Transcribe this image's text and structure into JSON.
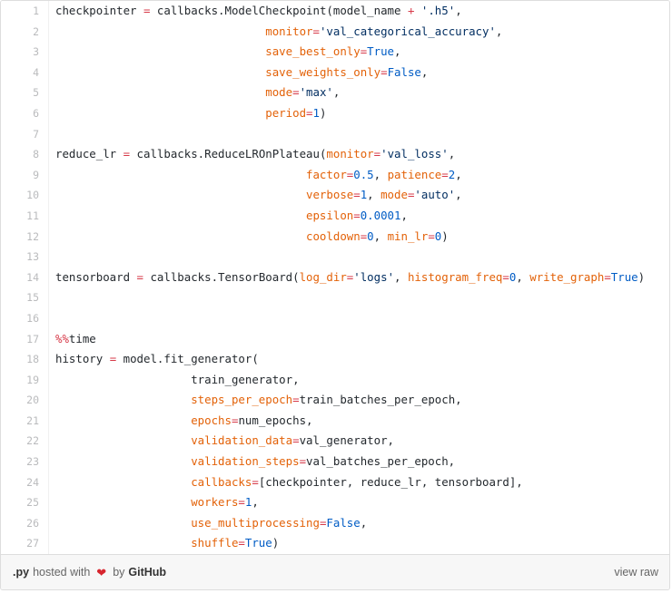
{
  "gist": {
    "language_ext": ".py",
    "hosted_with_text": "hosted with",
    "heart_icon": "heart-icon",
    "by_text": "by",
    "brand": "GitHub",
    "view_raw_label": "view raw",
    "colors": {
      "operator": "#d73a49",
      "keyword_arg": "#e36209",
      "string": "#032f62",
      "number": "#005cc5",
      "constant": "#005cc5",
      "plain": "#24292e",
      "line_number": "#babbbd",
      "footer_bg": "#f7f7f7",
      "border": "#dddddd",
      "heart": "#d7252e"
    }
  },
  "code": {
    "lines": [
      {
        "num": "1",
        "tokens": [
          {
            "t": "plain",
            "v": "checkpointer "
          },
          {
            "t": "op",
            "v": "="
          },
          {
            "t": "plain",
            "v": " callbacks.ModelCheckpoint(model_name "
          },
          {
            "t": "op",
            "v": "+"
          },
          {
            "t": "plain",
            "v": " "
          },
          {
            "t": "str",
            "v": "'.h5'"
          },
          {
            "t": "plain",
            "v": ","
          }
        ]
      },
      {
        "num": "2",
        "tokens": [
          {
            "t": "plain",
            "v": "                               "
          },
          {
            "t": "kwarg",
            "v": "monitor"
          },
          {
            "t": "op",
            "v": "="
          },
          {
            "t": "str",
            "v": "'val_categorical_accuracy'"
          },
          {
            "t": "plain",
            "v": ","
          }
        ]
      },
      {
        "num": "3",
        "tokens": [
          {
            "t": "plain",
            "v": "                               "
          },
          {
            "t": "kwarg",
            "v": "save_best_only"
          },
          {
            "t": "op",
            "v": "="
          },
          {
            "t": "const",
            "v": "True"
          },
          {
            "t": "plain",
            "v": ","
          }
        ]
      },
      {
        "num": "4",
        "tokens": [
          {
            "t": "plain",
            "v": "                               "
          },
          {
            "t": "kwarg",
            "v": "save_weights_only"
          },
          {
            "t": "op",
            "v": "="
          },
          {
            "t": "const",
            "v": "False"
          },
          {
            "t": "plain",
            "v": ","
          }
        ]
      },
      {
        "num": "5",
        "tokens": [
          {
            "t": "plain",
            "v": "                               "
          },
          {
            "t": "kwarg",
            "v": "mode"
          },
          {
            "t": "op",
            "v": "="
          },
          {
            "t": "str",
            "v": "'max'"
          },
          {
            "t": "plain",
            "v": ","
          }
        ]
      },
      {
        "num": "6",
        "tokens": [
          {
            "t": "plain",
            "v": "                               "
          },
          {
            "t": "kwarg",
            "v": "period"
          },
          {
            "t": "op",
            "v": "="
          },
          {
            "t": "num",
            "v": "1"
          },
          {
            "t": "plain",
            "v": ")"
          }
        ]
      },
      {
        "num": "7",
        "tokens": []
      },
      {
        "num": "8",
        "tokens": [
          {
            "t": "plain",
            "v": "reduce_lr "
          },
          {
            "t": "op",
            "v": "="
          },
          {
            "t": "plain",
            "v": " callbacks.ReduceLROnPlateau("
          },
          {
            "t": "kwarg",
            "v": "monitor"
          },
          {
            "t": "op",
            "v": "="
          },
          {
            "t": "str",
            "v": "'val_loss'"
          },
          {
            "t": "plain",
            "v": ","
          }
        ]
      },
      {
        "num": "9",
        "tokens": [
          {
            "t": "plain",
            "v": "                                     "
          },
          {
            "t": "kwarg",
            "v": "factor"
          },
          {
            "t": "op",
            "v": "="
          },
          {
            "t": "num",
            "v": "0.5"
          },
          {
            "t": "plain",
            "v": ", "
          },
          {
            "t": "kwarg",
            "v": "patience"
          },
          {
            "t": "op",
            "v": "="
          },
          {
            "t": "num",
            "v": "2"
          },
          {
            "t": "plain",
            "v": ","
          }
        ]
      },
      {
        "num": "10",
        "tokens": [
          {
            "t": "plain",
            "v": "                                     "
          },
          {
            "t": "kwarg",
            "v": "verbose"
          },
          {
            "t": "op",
            "v": "="
          },
          {
            "t": "num",
            "v": "1"
          },
          {
            "t": "plain",
            "v": ", "
          },
          {
            "t": "kwarg",
            "v": "mode"
          },
          {
            "t": "op",
            "v": "="
          },
          {
            "t": "str",
            "v": "'auto'"
          },
          {
            "t": "plain",
            "v": ","
          }
        ]
      },
      {
        "num": "11",
        "tokens": [
          {
            "t": "plain",
            "v": "                                     "
          },
          {
            "t": "kwarg",
            "v": "epsilon"
          },
          {
            "t": "op",
            "v": "="
          },
          {
            "t": "num",
            "v": "0.0001"
          },
          {
            "t": "plain",
            "v": ","
          }
        ]
      },
      {
        "num": "12",
        "tokens": [
          {
            "t": "plain",
            "v": "                                     "
          },
          {
            "t": "kwarg",
            "v": "cooldown"
          },
          {
            "t": "op",
            "v": "="
          },
          {
            "t": "num",
            "v": "0"
          },
          {
            "t": "plain",
            "v": ", "
          },
          {
            "t": "kwarg",
            "v": "min_lr"
          },
          {
            "t": "op",
            "v": "="
          },
          {
            "t": "num",
            "v": "0"
          },
          {
            "t": "plain",
            "v": ")"
          }
        ]
      },
      {
        "num": "13",
        "tokens": []
      },
      {
        "num": "14",
        "tokens": [
          {
            "t": "plain",
            "v": "tensorboard "
          },
          {
            "t": "op",
            "v": "="
          },
          {
            "t": "plain",
            "v": " callbacks.TensorBoard("
          },
          {
            "t": "kwarg",
            "v": "log_dir"
          },
          {
            "t": "op",
            "v": "="
          },
          {
            "t": "str",
            "v": "'logs'"
          },
          {
            "t": "plain",
            "v": ", "
          },
          {
            "t": "kwarg",
            "v": "histogram_freq"
          },
          {
            "t": "op",
            "v": "="
          },
          {
            "t": "num",
            "v": "0"
          },
          {
            "t": "plain",
            "v": ", "
          },
          {
            "t": "kwarg",
            "v": "write_graph"
          },
          {
            "t": "op",
            "v": "="
          },
          {
            "t": "const",
            "v": "True"
          },
          {
            "t": "plain",
            "v": ")"
          }
        ]
      },
      {
        "num": "15",
        "tokens": []
      },
      {
        "num": "16",
        "tokens": []
      },
      {
        "num": "17",
        "tokens": [
          {
            "t": "magic",
            "v": "%%"
          },
          {
            "t": "plain",
            "v": "time"
          }
        ]
      },
      {
        "num": "18",
        "tokens": [
          {
            "t": "plain",
            "v": "history "
          },
          {
            "t": "op",
            "v": "="
          },
          {
            "t": "plain",
            "v": " model.fit_generator("
          }
        ]
      },
      {
        "num": "19",
        "tokens": [
          {
            "t": "plain",
            "v": "                    train_generator,"
          }
        ]
      },
      {
        "num": "20",
        "tokens": [
          {
            "t": "plain",
            "v": "                    "
          },
          {
            "t": "kwarg",
            "v": "steps_per_epoch"
          },
          {
            "t": "op",
            "v": "="
          },
          {
            "t": "plain",
            "v": "train_batches_per_epoch,"
          }
        ]
      },
      {
        "num": "21",
        "tokens": [
          {
            "t": "plain",
            "v": "                    "
          },
          {
            "t": "kwarg",
            "v": "epochs"
          },
          {
            "t": "op",
            "v": "="
          },
          {
            "t": "plain",
            "v": "num_epochs,"
          }
        ]
      },
      {
        "num": "22",
        "tokens": [
          {
            "t": "plain",
            "v": "                    "
          },
          {
            "t": "kwarg",
            "v": "validation_data"
          },
          {
            "t": "op",
            "v": "="
          },
          {
            "t": "plain",
            "v": "val_generator,"
          }
        ]
      },
      {
        "num": "23",
        "tokens": [
          {
            "t": "plain",
            "v": "                    "
          },
          {
            "t": "kwarg",
            "v": "validation_steps"
          },
          {
            "t": "op",
            "v": "="
          },
          {
            "t": "plain",
            "v": "val_batches_per_epoch,"
          }
        ]
      },
      {
        "num": "24",
        "tokens": [
          {
            "t": "plain",
            "v": "                    "
          },
          {
            "t": "kwarg",
            "v": "callbacks"
          },
          {
            "t": "op",
            "v": "="
          },
          {
            "t": "plain",
            "v": "[checkpointer, reduce_lr, tensorboard],"
          }
        ]
      },
      {
        "num": "25",
        "tokens": [
          {
            "t": "plain",
            "v": "                    "
          },
          {
            "t": "kwarg",
            "v": "workers"
          },
          {
            "t": "op",
            "v": "="
          },
          {
            "t": "num",
            "v": "1"
          },
          {
            "t": "plain",
            "v": ","
          }
        ]
      },
      {
        "num": "26",
        "tokens": [
          {
            "t": "plain",
            "v": "                    "
          },
          {
            "t": "kwarg",
            "v": "use_multiprocessing"
          },
          {
            "t": "op",
            "v": "="
          },
          {
            "t": "const",
            "v": "False"
          },
          {
            "t": "plain",
            "v": ","
          }
        ]
      },
      {
        "num": "27",
        "tokens": [
          {
            "t": "plain",
            "v": "                    "
          },
          {
            "t": "kwarg",
            "v": "shuffle"
          },
          {
            "t": "op",
            "v": "="
          },
          {
            "t": "const",
            "v": "True"
          },
          {
            "t": "plain",
            "v": ")"
          }
        ]
      }
    ]
  }
}
